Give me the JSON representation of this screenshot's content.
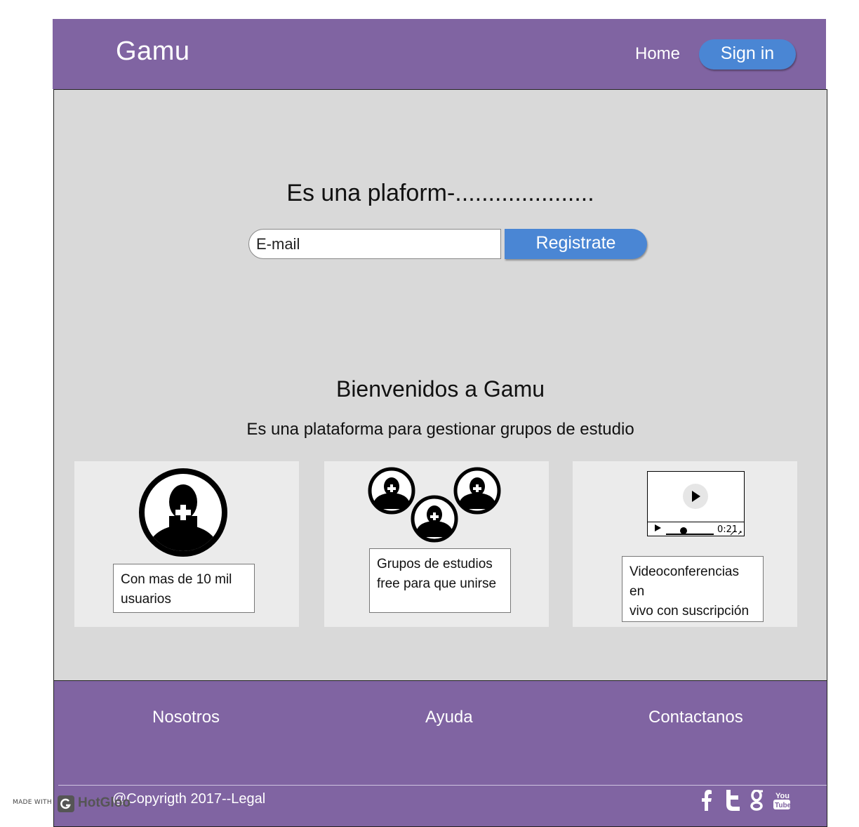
{
  "header": {
    "logo": "Gamu",
    "nav_home": "Home",
    "sign_in": "Sign in"
  },
  "hero": {
    "title": "Es una plaform-.....................",
    "email_placeholder": "E-mail",
    "register_label": "Registrate"
  },
  "about": {
    "title": "Bienvenidos a Gamu",
    "subtitle": "Es una plataforma para gestionar grupos de estudio",
    "cards": [
      {
        "text_line1": "Con mas de 10 mil",
        "text_line2": "usuarios",
        "icon": "user-add-icon"
      },
      {
        "text_line1": "Grupos de estudios",
        "text_line2": "free para que unirse",
        "icon": "group-icon"
      },
      {
        "text_line1": "Videoconferencias en",
        "text_line2": "vivo con suscripción",
        "icon": "video-player-icon",
        "video_time": "0:21"
      }
    ]
  },
  "footer": {
    "links": [
      "Nosotros",
      "Ayuda",
      "Contactanos"
    ],
    "copyright": "@Copyrigth 2017--Legal",
    "social": [
      "facebook-icon",
      "twitter-icon",
      "google-icon",
      "youtube-icon"
    ]
  },
  "watermark": {
    "made_with": "MADE WITH",
    "brand": "HotGloo"
  },
  "colors": {
    "header_bg": "#8064a2",
    "accent": "#4a86d4",
    "section_bg": "#d9d9d9",
    "card_bg": "#ebebeb"
  }
}
